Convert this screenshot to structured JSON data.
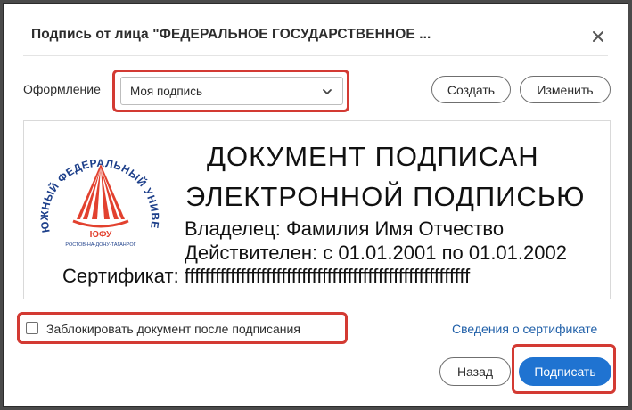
{
  "dialog": {
    "title": "Подпись от лица \"ФЕДЕРАЛЬНОЕ ГОСУДАРСТВЕННОЕ ...",
    "close_icon": "close-icon"
  },
  "appearance": {
    "label": "Оформление",
    "selected": "Моя подпись",
    "create_label": "Создать",
    "edit_label": "Изменить"
  },
  "signature_preview": {
    "logo_arc_text": "ЮЖНЫЙ ФЕДЕРАЛЬНЫЙ УНИВЕРСИТЕТ",
    "logo_abbr": "ЮФУ",
    "logo_city": "РОСТОВ-НА-ДОНУ-ТАГАНРОГ",
    "heading_line1": "ДОКУМЕНТ ПОДПИСАН",
    "heading_line2": "ЭЛЕКТРОННОЙ ПОДПИСЬЮ",
    "owner": "Владелец: Фамилия Имя Отчество",
    "valid": "Действителен: с 01.01.2001 по 01.01.2002",
    "certificate": "Сертификат: ffffffffffffffffffffffffffffffffffffffffffffffffffffffff"
  },
  "lock_option": {
    "label": "Заблокировать документ после подписания",
    "checked": false
  },
  "links": {
    "certificate_details": "Сведения о сертификате"
  },
  "footer": {
    "back_label": "Назад",
    "sign_label": "Подписать"
  },
  "colors": {
    "accent": "#1f73d1",
    "highlight": "#d33a33",
    "logo_red": "#e2412f",
    "logo_blue": "#1d3f8a"
  }
}
